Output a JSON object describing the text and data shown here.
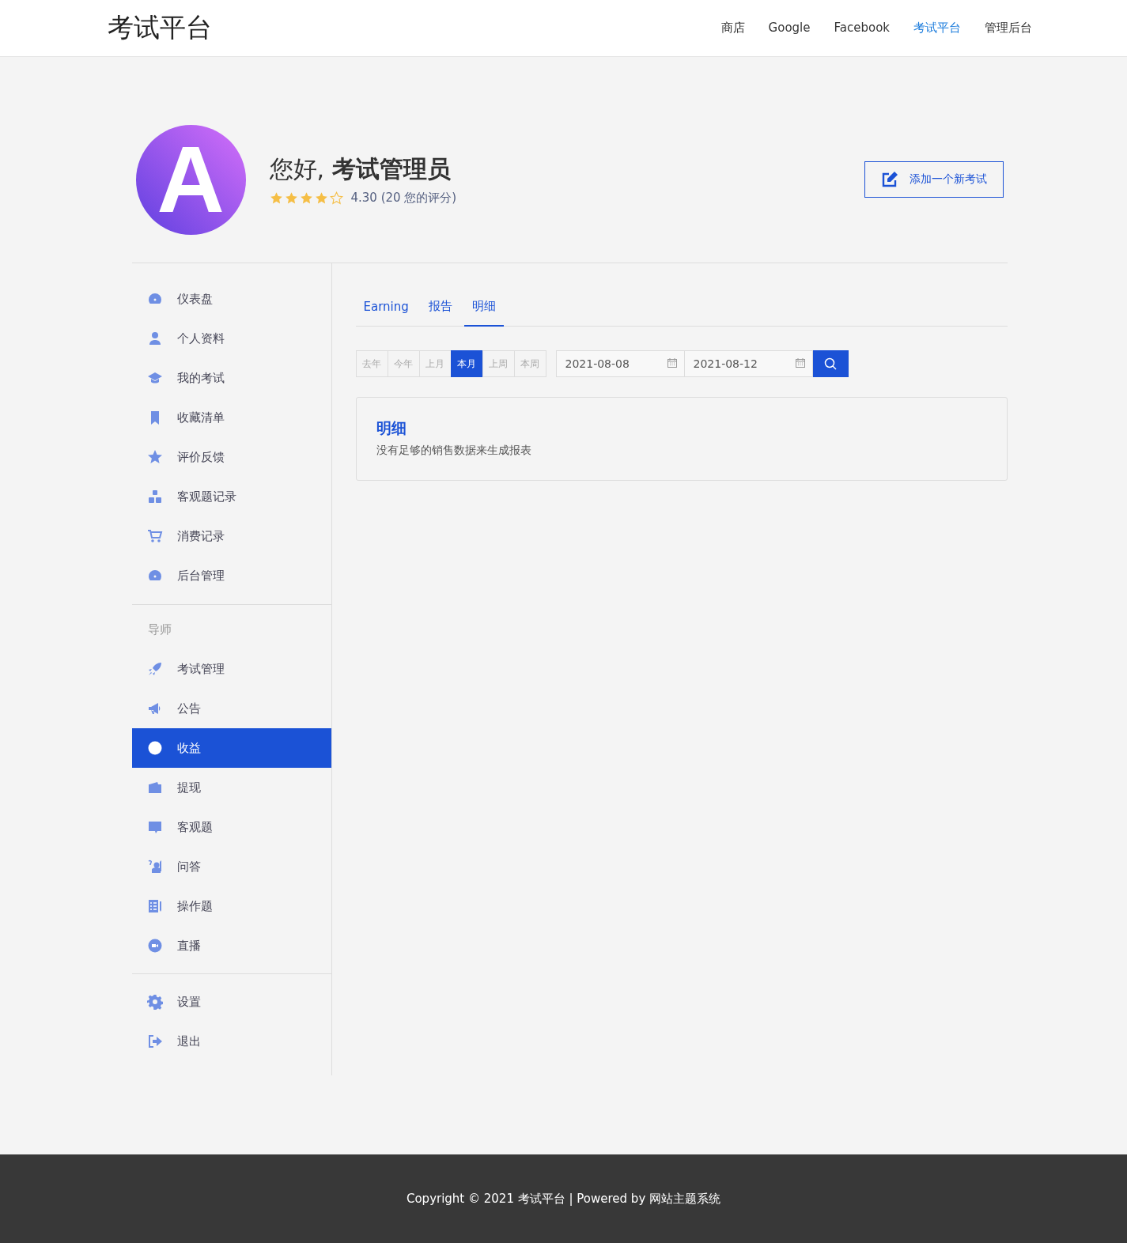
{
  "header": {
    "logo": "考试平台",
    "nav": [
      {
        "label": "商店",
        "selected": false
      },
      {
        "label": "Google",
        "selected": false
      },
      {
        "label": "Facebook",
        "selected": false
      },
      {
        "label": "考试平台",
        "selected": true
      },
      {
        "label": "管理后台",
        "selected": false
      }
    ]
  },
  "profile": {
    "avatar_letter": "A",
    "greeting": "您好, **考试管理员**",
    "stars": 4,
    "rating": "4.30 (20 您的评分)",
    "add_button": "添加一个新考试"
  },
  "sidebar": {
    "groups": [
      {
        "items": [
          {
            "label": "仪表盘",
            "selected": false
          },
          {
            "label": "个人资料",
            "selected": false
          },
          {
            "label": "我的考试",
            "selected": false
          },
          {
            "label": "收藏清单",
            "selected": false
          },
          {
            "label": "评价反馈",
            "selected": false
          },
          {
            "label": "客观题记录",
            "selected": false
          },
          {
            "label": "消费记录",
            "selected": false
          },
          {
            "label": "后台管理",
            "selected": false
          }
        ]
      },
      {
        "heading": "导师",
        "items": [
          {
            "label": "考试管理",
            "selected": false
          },
          {
            "label": "公告",
            "selected": false
          },
          {
            "label": "收益",
            "selected": true
          },
          {
            "label": "提现",
            "selected": false
          },
          {
            "label": "客观题",
            "selected": false
          },
          {
            "label": "问答",
            "selected": false
          },
          {
            "label": "操作题",
            "selected": false
          },
          {
            "label": "直播",
            "selected": false
          }
        ]
      },
      {
        "items": [
          {
            "label": "设置",
            "selected": false
          },
          {
            "label": "退出",
            "selected": false
          }
        ]
      }
    ]
  },
  "tabs": [
    {
      "label": "Earning",
      "selected": false
    },
    {
      "label": "报告",
      "selected": false
    },
    {
      "label": "明细",
      "selected": true
    }
  ],
  "periods": [
    {
      "label": "去年",
      "selected": false
    },
    {
      "label": "今年",
      "selected": false
    },
    {
      "label": "上月",
      "selected": false
    },
    {
      "label": "本月",
      "selected": true
    },
    {
      "label": "上周",
      "selected": false
    },
    {
      "label": "本周",
      "selected": false
    }
  ],
  "date_from": "2021-08-08",
  "date_to": "2021-08-12",
  "card": {
    "title": "明细",
    "message": "没有足够的销售数据来生成报表"
  },
  "footer": "Copyright © 2021 考试平台 | Powered by 网站主题系统"
}
